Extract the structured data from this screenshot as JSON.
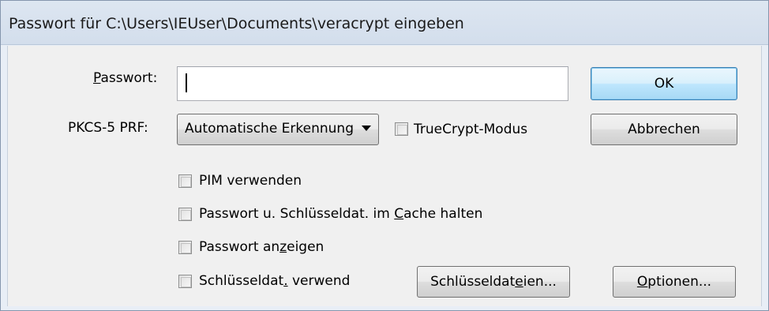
{
  "window": {
    "title": "Passwort für C:\\Users\\IEUser\\Documents\\veracrypt eingeben"
  },
  "password": {
    "label_underlined": "P",
    "label_rest": "asswort:",
    "value": ""
  },
  "prf": {
    "label": "PKCS-5 PRF:",
    "selected": "Automatische Erkennung"
  },
  "truecrypt": {
    "label": "TrueCrypt-Modus",
    "checked": false
  },
  "buttons": {
    "ok": "OK",
    "cancel": "Abbrechen",
    "keyfiles_pre": "Schlüsseldat",
    "keyfiles_u": "e",
    "keyfiles_post": "ien...",
    "options_u": "O",
    "options_post": "ptionen..."
  },
  "options": {
    "use_pim": {
      "label": "PIM verwenden",
      "checked": false
    },
    "cache": {
      "label_pre": "Passwort u. Schlüsseldat. im ",
      "label_u": "C",
      "label_post": "ache halten",
      "checked": false
    },
    "show_password": {
      "label_pre": "Passwort an",
      "label_u": "z",
      "label_post": "eigen",
      "checked": false
    },
    "use_keyfiles": {
      "label_pre": "Schlüsseldat",
      "label_u": ".",
      "label_post": " verwend",
      "checked": false
    }
  }
}
